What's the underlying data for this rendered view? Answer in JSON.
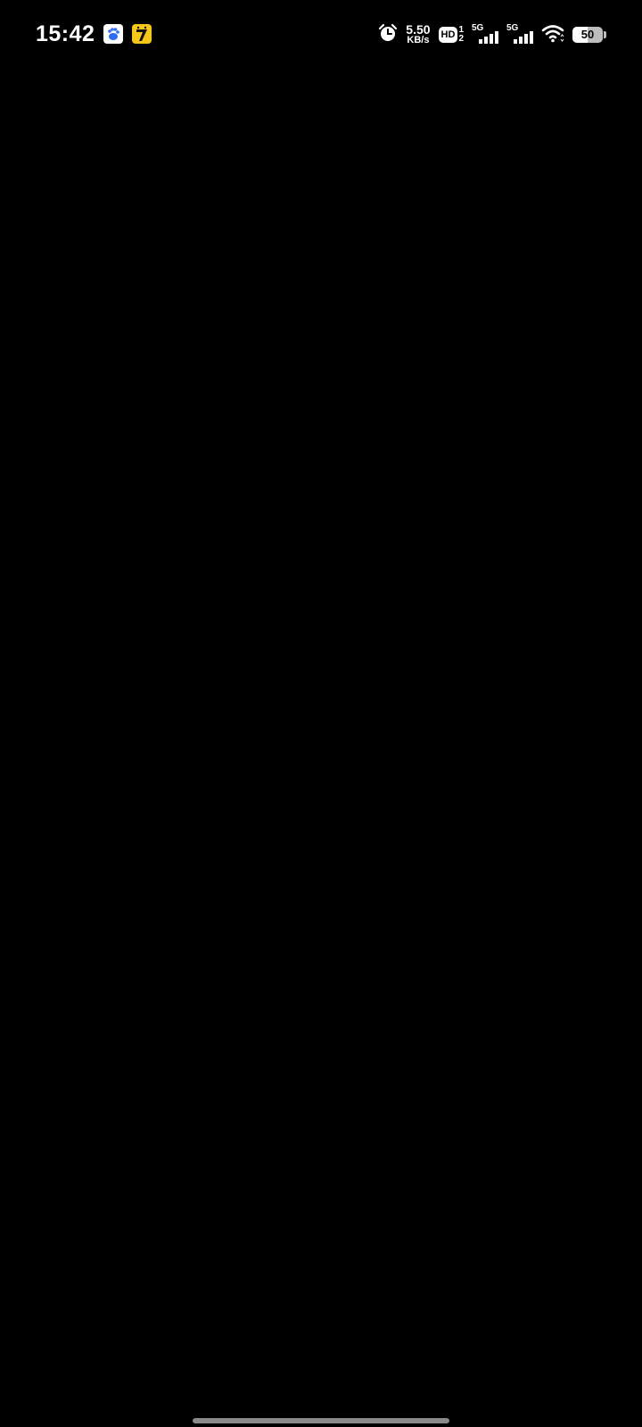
{
  "status_bar": {
    "time": "15:42",
    "notification_icons": [
      "baidu-app-icon",
      "game-app-icon"
    ],
    "network_speed_value": "5.50",
    "network_speed_unit": "KB/s",
    "hd_label": "HD",
    "hd_sim_1": "1",
    "hd_sim_2": "2",
    "sim1_network": "5G",
    "sim2_network": "5G",
    "battery_level": "50",
    "battery_fraction": 0.5
  },
  "colors": {
    "background": "#000000",
    "status_text": "#ffffff",
    "game_icon": "#f6c61b",
    "home_indicator": "#8a8a8a"
  }
}
